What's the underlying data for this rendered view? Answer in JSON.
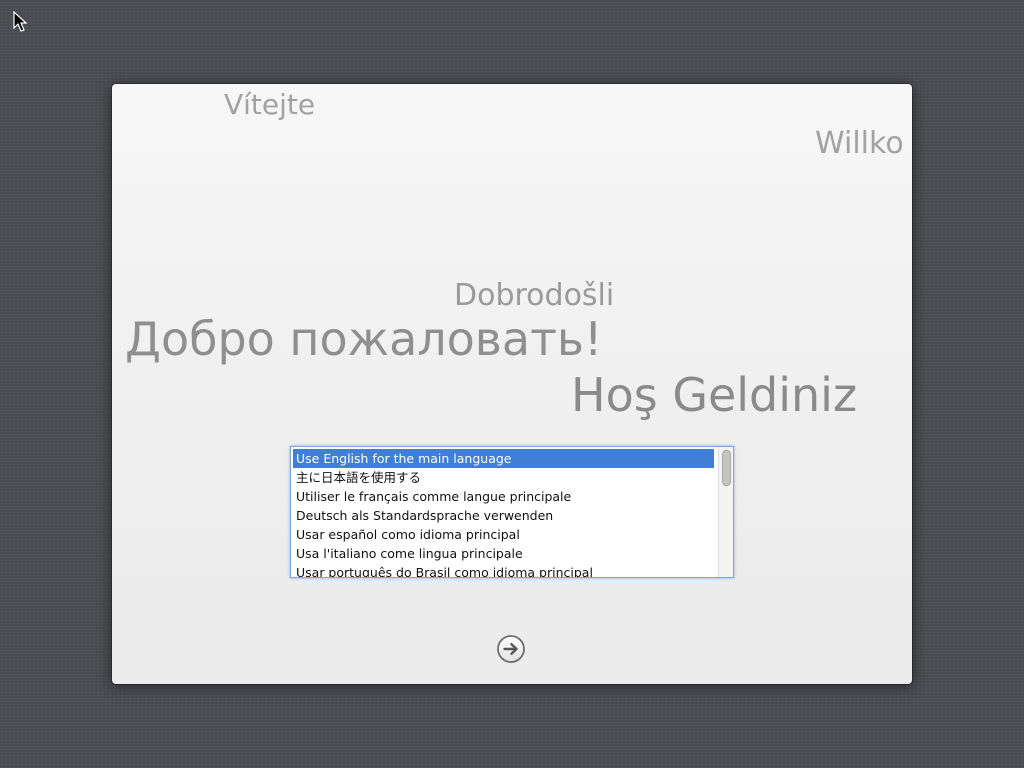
{
  "welcome_messages": [
    "Vítejte",
    "Willko",
    "Dobrodošli",
    "Добро пожаловать!",
    "Hoş Geldiniz"
  ],
  "language_list": {
    "selected_index": 0,
    "items": [
      "Use English for the main language",
      "主に日本語を使用する",
      "Utiliser le français comme langue principale",
      "Deutsch als Standardsprache verwenden",
      "Usar español como idioma principal",
      "Usa l'italiano come lingua principale",
      "Usar português do Brasil como idioma principal"
    ]
  },
  "continue_button": {
    "icon": "right-arrow-circle-icon"
  },
  "colors": {
    "desktop_background": "#4b4d52",
    "selection": "#3f7fd6",
    "list_focus_ring": "#7ea6d8"
  }
}
